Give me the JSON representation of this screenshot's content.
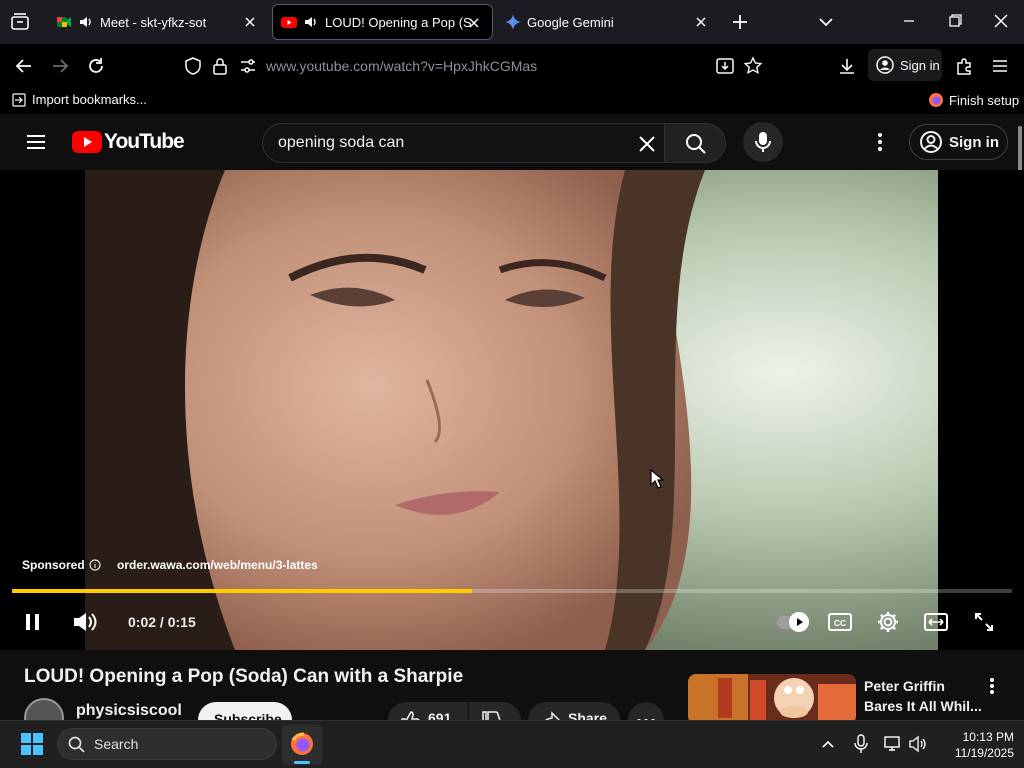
{
  "browser": {
    "tabs": [
      {
        "title": "Meet - skt-yfkz-sot",
        "active": false
      },
      {
        "title": "LOUD! Opening a Pop (Soda) Can with a Sharpie",
        "active": true
      },
      {
        "title": "Google Gemini",
        "active": false
      }
    ],
    "url": "www.youtube.com/watch?v=HpxJhkCGMas",
    "sign_in_label": "Sign in",
    "import_bookmarks_label": "Import bookmarks...",
    "finish_setup_label": "Finish setup"
  },
  "youtube": {
    "logo_text": "YouTube",
    "search_value": "opening soda can",
    "sign_in_label": "Sign in"
  },
  "player": {
    "sponsored_label": "Sponsored",
    "ad_url": "order.wawa.com/web/menu/3-lattes",
    "time_current": "0:02",
    "time_total": "0:15",
    "time_display": "0:02 / 0:15",
    "progress": 0.46,
    "cc_label": "CC"
  },
  "video": {
    "title": "LOUD! Opening a Pop (Soda) Can with a Sharpie",
    "channel": "physicsiscool",
    "subscribe_label": "Subscribe",
    "likes": "691",
    "share_label": "Share"
  },
  "recommended": {
    "title_line1": "Peter Griffin",
    "title_line2": "Bares It All Whil..."
  },
  "taskbar": {
    "search_placeholder": "Search",
    "time": "10:13 PM",
    "date": "11/19/2025"
  },
  "colors": {
    "progress": "#ffcc00",
    "youtube_red": "#ff0000",
    "chrome_bg": "#1c1b22"
  }
}
